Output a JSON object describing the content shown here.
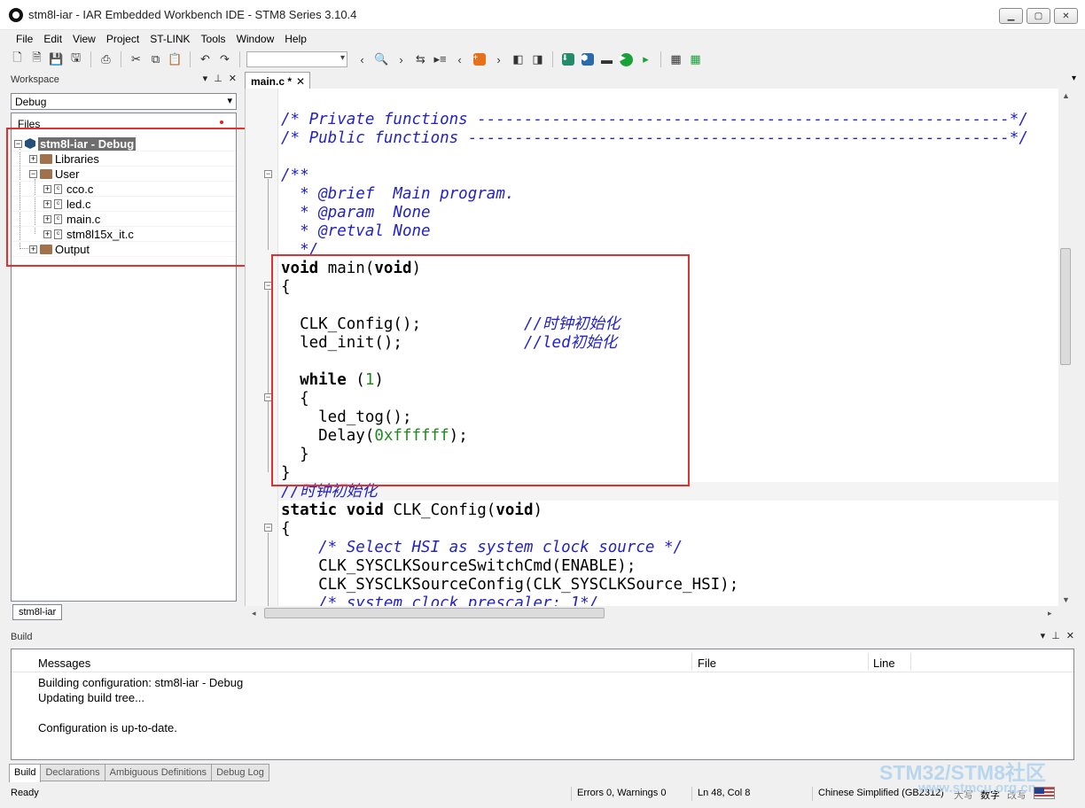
{
  "window": {
    "title": "stm8l-iar - IAR Embedded Workbench IDE - STM8 Series 3.10.4",
    "buttons": [
      "minimize",
      "maximize",
      "close"
    ]
  },
  "menu": [
    "File",
    "Edit",
    "View",
    "Project",
    "ST-LINK",
    "Tools",
    "Window",
    "Help"
  ],
  "toolbar": {
    "search_value": ""
  },
  "workspace": {
    "title": "Workspace",
    "config": "Debug",
    "files_header": "Files",
    "tab": "stm8l-iar",
    "tree": [
      {
        "label": "stm8l-iar - Debug",
        "type": "project",
        "level": 0,
        "selected": true
      },
      {
        "label": "Libraries",
        "type": "folder",
        "level": 1
      },
      {
        "label": "User",
        "type": "folder",
        "level": 1,
        "expanded": true
      },
      {
        "label": "cco.c",
        "type": "file",
        "level": 2
      },
      {
        "label": "led.c",
        "type": "file",
        "level": 2
      },
      {
        "label": "main.c",
        "type": "file",
        "level": 2
      },
      {
        "label": "stm8l15x_it.c",
        "type": "file",
        "level": 2
      },
      {
        "label": "Output",
        "type": "folder",
        "level": 1
      }
    ]
  },
  "editor": {
    "tab_label": "main.c *",
    "func_icon": "f()",
    "lines": [
      "/* Private functions ---------------------------------------------------------*/",
      "/* Public functions ----------------------------------------------------------*/",
      "",
      "/**",
      "  * @brief  Main program.",
      "  * @param  None",
      "  * @retval None",
      "  */",
      "void main(void)",
      "{",
      "",
      "  CLK_Config();            //时钟初始化",
      "  led_init();              //led初始化",
      "",
      "  while (1)",
      "  {",
      "    led_tog();",
      "    Delay(0xffffff);",
      "  }",
      "}",
      "//时钟初始化",
      "static void CLK_Config(void)",
      "{",
      "    /* Select HSI as system clock source */",
      "    CLK_SYSCLKSourceSwitchCmd(ENABLE);",
      "    CLK_SYSCLKSourceConfig(CLK_SYSCLKSource_HSI);",
      "    /* system clock prescaler: 1*/"
    ]
  },
  "build": {
    "title": "Build",
    "columns": [
      "Messages",
      "File",
      "Line"
    ],
    "messages": [
      "Building configuration: stm8l-iar - Debug",
      "Updating build tree...",
      "",
      "Configuration is up-to-date."
    ],
    "tabs": [
      "Build",
      "Declarations",
      "Ambiguous Definitions",
      "Debug Log"
    ]
  },
  "status": {
    "ready": "Ready",
    "errors": "Errors 0, Warnings 0",
    "position": "Ln 48, Col 8",
    "encoding": "Chinese Simplified (GB2312)",
    "ime1": "大写",
    "ime2": "数字",
    "ime3": "改写"
  },
  "watermark": {
    "line1": "STM32/STM8社区",
    "line2": "www.stmcu.org.cn"
  },
  "colors": {
    "comment": "#2222c8",
    "number": "#1f8a1f",
    "highlight_box": "#e03030",
    "selection": "#6e6e6e"
  }
}
